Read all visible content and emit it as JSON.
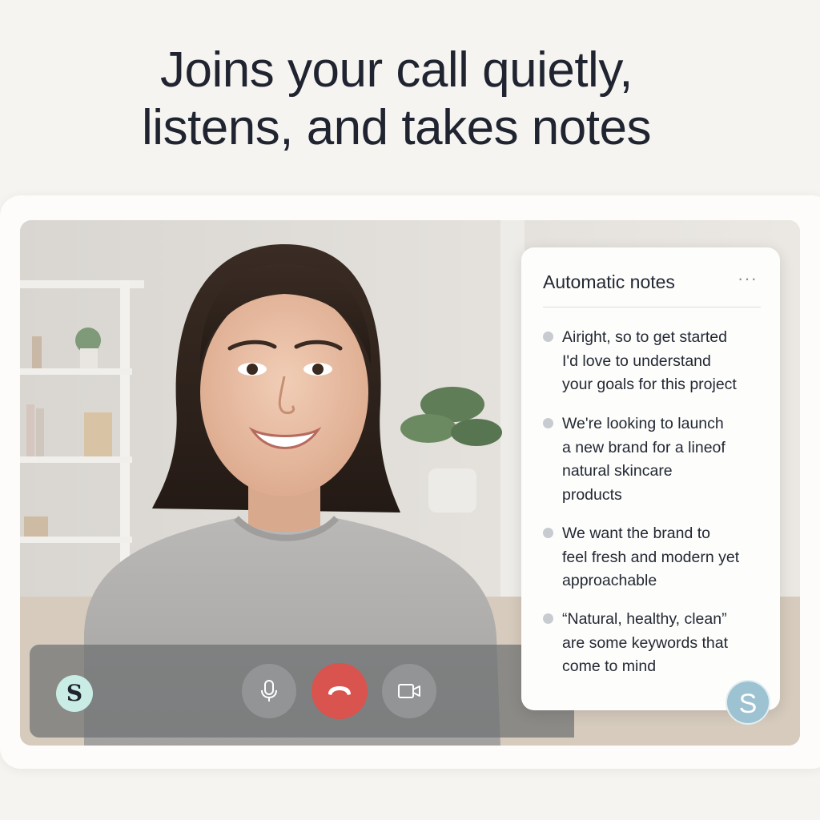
{
  "headline": {
    "line1": "Joins your call quietly,",
    "line2": "listens, and takes notes"
  },
  "call": {
    "participant_avatar_letter": "S",
    "controls": {
      "mic_icon": "microphone-icon",
      "end_icon": "phone-hangup-icon",
      "camera_icon": "video-camera-icon"
    },
    "colors": {
      "end_call": "#d9534f",
      "avatar_left": "#c9ece4",
      "avatar_right": "#9dc3d2"
    }
  },
  "notes": {
    "title": "Automatic notes",
    "more_label": "···",
    "items": [
      {
        "text": "Airight, so to get started\nI'd love to understand\nyour goals for this project"
      },
      {
        "text": "We're looking to launch\na new brand for a lineof\nnatural skincare\nproducts"
      },
      {
        "text": "We want the brand to\nfeel fresh and modern yet\napproachable"
      },
      {
        "text": "“Natural, healthy, clean”\nare some keywords that\ncome to mind"
      }
    ],
    "assistant_avatar_letter": "S"
  }
}
